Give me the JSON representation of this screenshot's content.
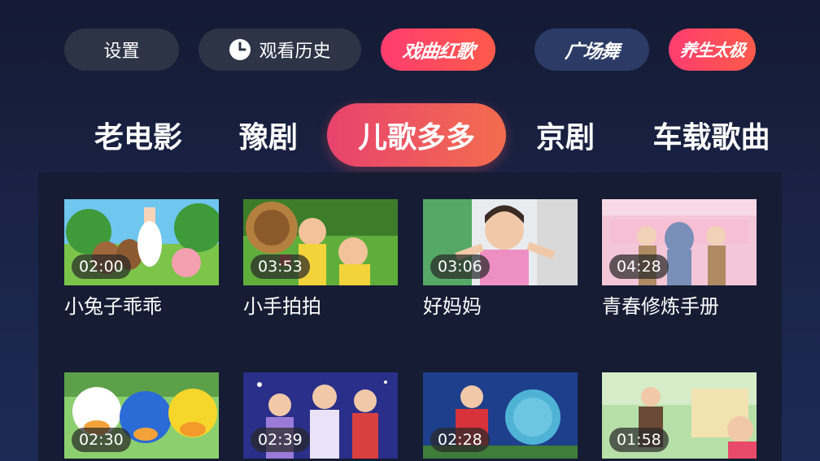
{
  "top_buttons": {
    "settings": "设置",
    "history": "观看历史",
    "opera_songs": "戏曲红歌",
    "square_dance": "广场舞",
    "health_taiji": "养生太极"
  },
  "icons": {
    "history": "clock-icon"
  },
  "colors": {
    "accent_gradient_start": "#ff3d71",
    "accent_gradient_end": "#ff5a4a",
    "pill_dark": "#2d3446",
    "pill_blue": "#2b3b66",
    "panel": "#161c33"
  },
  "tabs": [
    {
      "label": "老电影",
      "selected": false
    },
    {
      "label": "豫剧",
      "selected": false
    },
    {
      "label": "儿歌多多",
      "selected": true
    },
    {
      "label": "京剧",
      "selected": false
    },
    {
      "label": "车载歌曲",
      "selected": false
    }
  ],
  "videos": [
    {
      "title": "小兔子乖乖",
      "duration": "02:00"
    },
    {
      "title": "小手拍拍",
      "duration": "03:53"
    },
    {
      "title": "好妈妈",
      "duration": "03:06"
    },
    {
      "title": "青春修炼手册",
      "duration": "04:28"
    },
    {
      "title": "",
      "duration": "02:30"
    },
    {
      "title": "",
      "duration": "02:39"
    },
    {
      "title": "",
      "duration": "02:28"
    },
    {
      "title": "",
      "duration": "01:58"
    }
  ]
}
